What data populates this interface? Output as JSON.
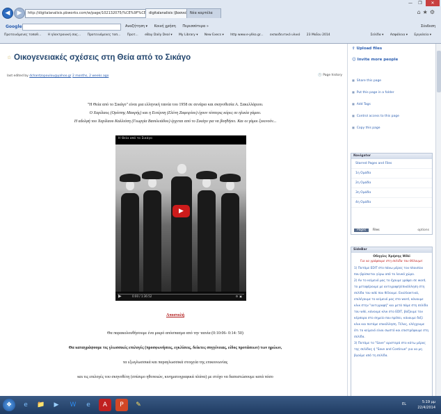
{
  "browser": {
    "url": "http://digitalanalisis.pbworks.com/w/page/102132075/%CE%9F%CE%B9%CE%BA%CE%BF",
    "tabs": [
      "digitalanalisis (βασικό) Ι...",
      "Νέα καρτέλα"
    ],
    "window_controls": [
      "—",
      "❐",
      "✕"
    ],
    "google": {
      "logo": "Google",
      "items": [
        "Αναζήτηση ▾",
        "Κοινή χρήση",
        "Περισσότερα »"
      ],
      "account": "Σύνδεση"
    },
    "bookmarks": [
      "Προτεινόμενες τοποθ...",
      "Η ηλεκτρονική σας...",
      "Προτεινόμενες τοπ...",
      "Προτ...",
      "eBay Daily Deal ▾",
      "My Library ▾",
      "New Execs ▾",
      "http www.e-yliko.gr...",
      "εκπαιδευτικό υλικό",
      "23 Μαΐου 2014",
      "Εργασία - παιγνίδι ▾"
    ],
    "tools": [
      "Σελίδα ▾",
      "Ασφάλεια ▾",
      "Εργαλεία ▾"
    ]
  },
  "page": {
    "title": "Οικογενειακές σχέσεις στη Θεία από το Σικάγο",
    "edit_prefix": "last edited by",
    "editor": "dchantzopoulou@yahoo.gr",
    "edit_time": "2 months, 2 weeks ago",
    "history": "Page history",
    "intro": [
      "\"Η Θεία από το Σικάγο\" είναι μια ελληνική ταινία του 1958 σε σενάριο και σκηνοθεσία Α. Σακελλάριου.",
      "Ο Χαρίλαος (Ορέστης Μακρής) και η Ευτέρπη (Ελένη Ζαφειρίου) έχουν τέσσερις κόρες σε ηλικία γάμου.",
      "Η αδελφή του Χαρίλαου Καλλιόπη (Γεωργία Βασιλειάδου) έρχεται από το Σικάγο για να βοηθήσει. Και οι γάμοι ξεκινούν..."
    ],
    "video": {
      "title": "Η Θεία από το Σικάγο",
      "time": "0:00 / 1:36:52"
    },
    "section_heading": "Αποστολή",
    "body": [
      "Θα παρακολουθήσουμε ένα μικρό απόσπασμα από την ταινία (0:10:06- 0:14: 50)",
      "Θα καταγράψουμε τις γλωσσικές επιλογές (προσφωνήσεις, εγκλίσεις, δείκτες συγγένειας, είδος προτάσεων) των ηρώων,",
      "τα εξωγλωσσικά και παραγλωσσικά στοιχεία της επικοινωνίας",
      "και τις επιλογές του σκηνοθέτη (σπίσιμο ηθοποιών, κινηματογραφικά πλάνα) με στόχο να διαπιστώσουμε κατά πόσο"
    ]
  },
  "sidebar": {
    "upload": "Upload files",
    "invite": "Invite more people",
    "actions": [
      "Share this page",
      "Put this page in a folder",
      "Add Tags",
      "Control access to this page",
      "Copy this page"
    ],
    "navigator": {
      "title": "Navigator",
      "items": [
        "Starred Pages and Files",
        "1η Ομάδα",
        "2η Ομάδα",
        "3η Ομάδα",
        "4η Ομάδα"
      ],
      "tabs": [
        "Pages",
        "Files"
      ],
      "options": "options"
    },
    "sidebar_panel": {
      "title": "SideBar",
      "heading": "Οδηγίες Χρήσης Wiki",
      "subheading": "Για να γράψουμε στη σελίδα του θέλουμε:",
      "steps": [
        "1) Πατάμε EDIT στο πάνω μέρος του πλαισίου που βρίσκεται γύρω από το λευκό χώρο.",
        "2) Αν το κείμενό μας το έχουμε γράψει σε word, το μεταφέρουμε με αντιγραφή/επικόλληση στη σελίδα του wiki που θέλουμε. Εναλλακτικά, επιλέγουμε το κείμενό μας στο word, κάνουμε κλικ στην \"αντιγραφή\" και μετά πάμε στη σελίδα του wiki, κάνουμε κλικ στο EDIT, βάζουμε τον κέρσορα στο σημείο που πρέπει, κάνουμε δεξί κλικ και πατάμε επικόλληση. Τέλος, ελέγχουμε ότι το κείμενό είναι σωστό και επιστρέφουμε στη σελίδα.",
        "3) Πατάμε το \"Save\" αριστερά στο κάτω μέρος της σελίδας ή \"Save and Continue\" για να μη βγούμε από τη σελίδα."
      ],
      "zoom": "125%"
    }
  },
  "taskbar": {
    "lang": "EL",
    "time": "5:19 μμ",
    "date": "22/4/2014"
  }
}
